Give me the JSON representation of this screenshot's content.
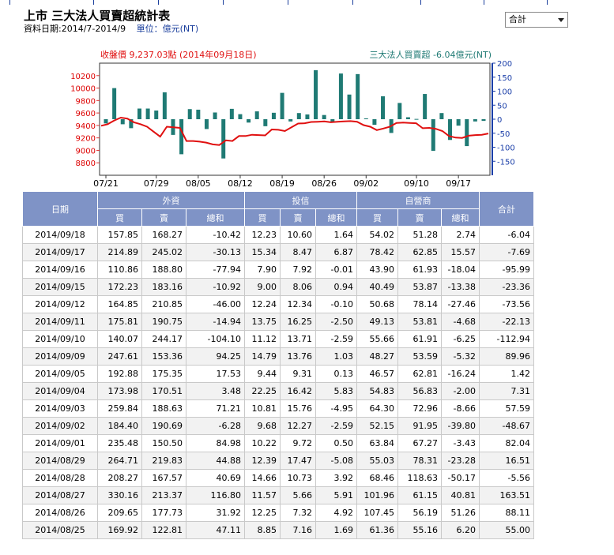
{
  "header": {
    "title": "上市 三大法人買賣超統計表",
    "date_range": "資料日期:2014/7-2014/9",
    "unit_label": "單位：億元(NT)"
  },
  "period_select": {
    "value": "合計"
  },
  "colors": {
    "header_bg": "#7f93c6",
    "price_line": "#e01010",
    "bar": "#1f7a74",
    "nav": "#1a3e9c"
  },
  "chart_data": {
    "type": "bar+line",
    "legend_left": "收盤價 9,237.03點 (2014年09月18日)",
    "legend_right": "三大法人買賣超 -6.04億元(NT)",
    "left_axis": {
      "ticks": [
        10200,
        10000,
        9800,
        9600,
        9400,
        9200,
        9000,
        8800
      ],
      "range": [
        8600,
        10400
      ]
    },
    "right_axis": {
      "ticks": [
        200,
        150,
        100,
        50,
        0,
        -50,
        -100,
        -150
      ],
      "range": [
        -200,
        200
      ]
    },
    "x_tick_labels": [
      "07/21",
      "07/29",
      "08/05",
      "08/12",
      "08/19",
      "08/26",
      "09/02",
      "09/10",
      "09/17"
    ],
    "x_tick_indexes": [
      0,
      6,
      11,
      16,
      21,
      26,
      31,
      37,
      42
    ],
    "bar_series": {
      "name": "三大法人買賣超",
      "values": [
        -15,
        111,
        -18,
        -32,
        38,
        38,
        31,
        96,
        -56,
        -125,
        36,
        34,
        -35,
        24,
        -140,
        37,
        18,
        -12,
        28,
        -25,
        23,
        94,
        -8,
        22,
        17,
        175,
        15,
        -11,
        163,
        88,
        161,
        3,
        -20,
        82,
        -49,
        58,
        7,
        1,
        90,
        -113,
        22,
        -74,
        -23,
        -96,
        -8,
        -6
      ]
    },
    "line_series": {
      "name": "收盤價",
      "values": [
        9395,
        9420,
        9480,
        9525,
        9510,
        9450,
        9420,
        9380,
        9300,
        9220,
        9380,
        9370,
        9360,
        9150,
        9150,
        9140,
        9125,
        9095,
        9085,
        9160,
        9150,
        9230,
        9230,
        9250,
        9245,
        9240,
        9335,
        9330,
        9310,
        9370,
        9430,
        9435,
        9455,
        9460,
        9465,
        9450,
        9460,
        9465,
        9470,
        9460,
        9405,
        9380,
        9325,
        9350,
        9380,
        9440,
        9445,
        9440,
        9435,
        9355,
        9360,
        9345,
        9310,
        9230,
        9205,
        9200,
        9235,
        9245,
        9250,
        9270
      ]
    }
  },
  "table": {
    "headers": {
      "date": "日期",
      "groups": [
        "外資",
        "投信",
        "自營商"
      ],
      "total": "合計",
      "sub": [
        "買",
        "賣",
        "總和",
        "買",
        "賣",
        "總和",
        "買",
        "賣",
        "總和"
      ]
    },
    "rows": [
      [
        "2014/09/18",
        "157.85",
        "168.27",
        "-10.42",
        "12.23",
        "10.60",
        "1.64",
        "54.02",
        "51.28",
        "2.74",
        "-6.04"
      ],
      [
        "2014/09/17",
        "214.89",
        "245.02",
        "-30.13",
        "15.34",
        "8.47",
        "6.87",
        "78.42",
        "62.85",
        "15.57",
        "-7.69"
      ],
      [
        "2014/09/16",
        "110.86",
        "188.80",
        "-77.94",
        "7.90",
        "7.92",
        "-0.01",
        "43.90",
        "61.93",
        "-18.04",
        "-95.99"
      ],
      [
        "2014/09/15",
        "172.23",
        "183.16",
        "-10.92",
        "9.00",
        "8.06",
        "0.94",
        "40.49",
        "53.87",
        "-13.38",
        "-23.36"
      ],
      [
        "2014/09/12",
        "164.85",
        "210.85",
        "-46.00",
        "12.24",
        "12.34",
        "-0.10",
        "50.68",
        "78.14",
        "-27.46",
        "-73.56"
      ],
      [
        "2014/09/11",
        "175.81",
        "190.75",
        "-14.94",
        "13.75",
        "16.25",
        "-2.50",
        "49.13",
        "53.81",
        "-4.68",
        "-22.13"
      ],
      [
        "2014/09/10",
        "140.07",
        "244.17",
        "-104.10",
        "11.12",
        "13.71",
        "-2.59",
        "55.66",
        "61.91",
        "-6.25",
        "-112.94"
      ],
      [
        "2014/09/09",
        "247.61",
        "153.36",
        "94.25",
        "14.79",
        "13.76",
        "1.03",
        "48.27",
        "53.59",
        "-5.32",
        "89.96"
      ],
      [
        "2014/09/05",
        "192.88",
        "175.35",
        "17.53",
        "9.44",
        "9.31",
        "0.13",
        "46.57",
        "62.81",
        "-16.24",
        "1.42"
      ],
      [
        "2014/09/04",
        "173.98",
        "170.51",
        "3.48",
        "22.25",
        "16.42",
        "5.83",
        "54.83",
        "56.83",
        "-2.00",
        "7.31"
      ],
      [
        "2014/09/03",
        "259.84",
        "188.63",
        "71.21",
        "10.81",
        "15.76",
        "-4.95",
        "64.30",
        "72.96",
        "-8.66",
        "57.59"
      ],
      [
        "2014/09/02",
        "184.40",
        "190.69",
        "-6.28",
        "9.68",
        "12.27",
        "-2.59",
        "52.15",
        "91.95",
        "-39.80",
        "-48.67"
      ],
      [
        "2014/09/01",
        "235.48",
        "150.50",
        "84.98",
        "10.22",
        "9.72",
        "0.50",
        "63.84",
        "67.27",
        "-3.43",
        "82.04"
      ],
      [
        "2014/08/29",
        "264.71",
        "219.83",
        "44.88",
        "12.39",
        "17.47",
        "-5.08",
        "55.03",
        "78.31",
        "-23.28",
        "16.51"
      ],
      [
        "2014/08/28",
        "208.27",
        "167.57",
        "40.69",
        "14.66",
        "10.73",
        "3.92",
        "68.46",
        "118.63",
        "-50.17",
        "-5.56"
      ],
      [
        "2014/08/27",
        "330.16",
        "213.37",
        "116.80",
        "11.57",
        "5.66",
        "5.91",
        "101.96",
        "61.15",
        "40.81",
        "163.51"
      ],
      [
        "2014/08/26",
        "209.65",
        "177.73",
        "31.92",
        "12.25",
        "7.32",
        "4.92",
        "107.45",
        "56.19",
        "51.26",
        "88.11"
      ],
      [
        "2014/08/25",
        "169.92",
        "122.81",
        "47.11",
        "8.85",
        "7.16",
        "1.69",
        "61.36",
        "55.16",
        "6.20",
        "55.00"
      ]
    ]
  }
}
